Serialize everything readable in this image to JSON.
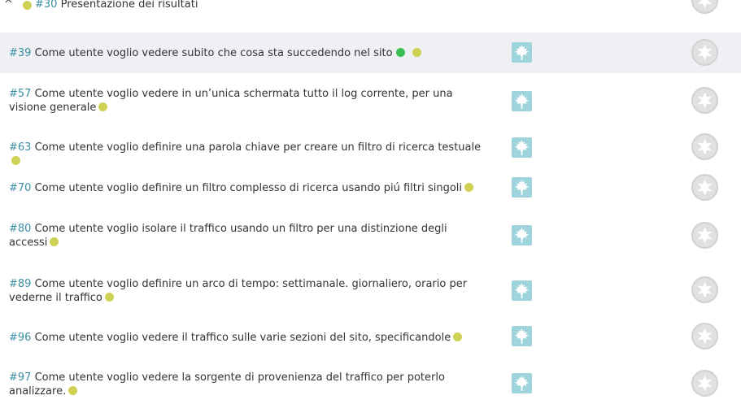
{
  "group": {
    "id": "#30",
    "title": "Presentazione dei risultati"
  },
  "stories": [
    {
      "id": "#39",
      "text": "Come utente voglio vedere subito che cosa sta succedendo nel sito"
    },
    {
      "id": "#57",
      "text": "Come utente voglio vedere in un’unica schermata tutto il log corrente, per una visione generale"
    },
    {
      "id": "#63",
      "text": "Come utente voglio definire una parola chiave per creare un filtro di ricerca testuale"
    },
    {
      "id": "#70",
      "text": "Come utente voglio definire un filtro complesso di ricerca usando piú filtri singoli"
    },
    {
      "id": "#80",
      "text": "Come utente voglio isolare il traffico usando un filtro per una distinzione degli accessi"
    },
    {
      "id": "#89",
      "text": "Come utente voglio definire un arco di tempo: settimanale. giornaliero, orario per vederne il traffico"
    },
    {
      "id": "#96",
      "text": "Come utente voglio vedere il traffico sulle varie sezioni del sito, specificandole"
    },
    {
      "id": "#97",
      "text": "Come utente voglio vedere la sorgente di provenienza del traffico per poterlo analizzare."
    }
  ],
  "colors": {
    "id_link": "#3a8fa3",
    "status_yellow": "#cfd155",
    "status_green": "#3bbf55",
    "assignee_bg": "#9ed5dc",
    "row_highlight": "#eef0f3"
  },
  "icons": {
    "collapse": "chevron-up-icon",
    "assignee": "maple-leaf-icon",
    "avatar": "default-avatar-icon"
  }
}
